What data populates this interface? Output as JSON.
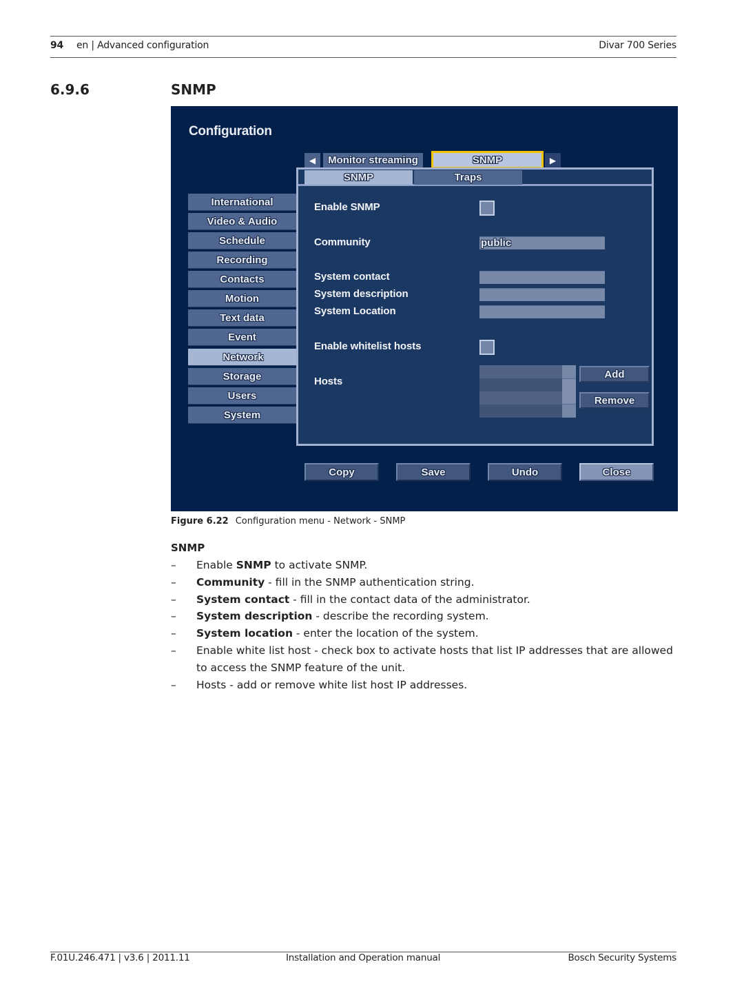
{
  "header": {
    "page_number": "94",
    "section_path": "en | Advanced configuration",
    "product": "Divar 700 Series"
  },
  "section": {
    "number": "6.9.6",
    "title": "SNMP"
  },
  "screen": {
    "title": "Configuration",
    "top_tabs": {
      "prev_icon": "triangle-left-icon",
      "next_icon": "triangle-right-icon",
      "items": [
        {
          "label": "Monitor streaming",
          "selected": false
        },
        {
          "label": "SNMP",
          "selected": true
        }
      ]
    },
    "sub_tabs": [
      {
        "label": "SNMP",
        "selected": true
      },
      {
        "label": "Traps",
        "selected": false
      }
    ],
    "menu": [
      {
        "label": "International",
        "active": false
      },
      {
        "label": "Video & Audio",
        "active": false
      },
      {
        "label": "Schedule",
        "active": false
      },
      {
        "label": "Recording",
        "active": false
      },
      {
        "label": "Contacts",
        "active": false
      },
      {
        "label": "Motion",
        "active": false
      },
      {
        "label": "Text data",
        "active": false
      },
      {
        "label": "Event",
        "active": false
      },
      {
        "label": "Network",
        "active": true
      },
      {
        "label": "Storage",
        "active": false
      },
      {
        "label": "Users",
        "active": false
      },
      {
        "label": "System",
        "active": false
      }
    ],
    "fields": {
      "enable_snmp": {
        "label": "Enable SNMP",
        "checked": false
      },
      "community": {
        "label": "Community",
        "value": "public"
      },
      "system_contact": {
        "label": "System contact",
        "value": ""
      },
      "system_description": {
        "label": "System description",
        "value": ""
      },
      "system_location": {
        "label": "System Location",
        "value": ""
      },
      "enable_whitelist": {
        "label": "Enable whitelist hosts",
        "checked": false
      },
      "hosts": {
        "label": "Hosts",
        "rows": [
          "",
          "",
          "",
          ""
        ]
      }
    },
    "host_buttons": {
      "add": "Add",
      "remove": "Remove"
    },
    "bottom_buttons": {
      "copy": "Copy",
      "save": "Save",
      "undo": "Undo",
      "close": "Close"
    }
  },
  "caption": {
    "figure_label": "Figure  6.22",
    "text": "Configuration menu - Network - SNMP"
  },
  "body": {
    "heading": "SNMP",
    "bullets": [
      {
        "dash": "–",
        "pre": "Enable ",
        "bold": "SNMP",
        "post": " to activate SNMP."
      },
      {
        "dash": "–",
        "pre": "",
        "bold": "Community",
        "post": " - fill in the SNMP authentication string."
      },
      {
        "dash": "–",
        "pre": "",
        "bold": "System contact",
        "post": " - fill in the contact data of the administrator."
      },
      {
        "dash": "–",
        "pre": "",
        "bold": "System description",
        "post": " - describe the recording system."
      },
      {
        "dash": "–",
        "pre": "",
        "bold": "System location",
        "post": " - enter the location of the system."
      },
      {
        "dash": "–",
        "pre": "Enable white list host - check box to activate hosts that list IP addresses that are allowed to access the SNMP feature of the unit.",
        "bold": "",
        "post": ""
      },
      {
        "dash": "–",
        "pre": "Hosts - add or remove white list host IP addresses.",
        "bold": "",
        "post": ""
      }
    ]
  },
  "footer": {
    "doc_id": "F.01U.246.471 | v3.6 | 2011.11",
    "manual": "Installation and Operation manual",
    "company": "Bosch Security Systems"
  },
  "colors": {
    "screen_bg": "#03204a",
    "panel_bg": "#1b3862",
    "tab_highlight_border": "#f2c500",
    "selected_tab_bg": "#b9c6e1",
    "menu_item_bg": "#4f6790",
    "menu_active_bg": "#a5b5d4"
  }
}
